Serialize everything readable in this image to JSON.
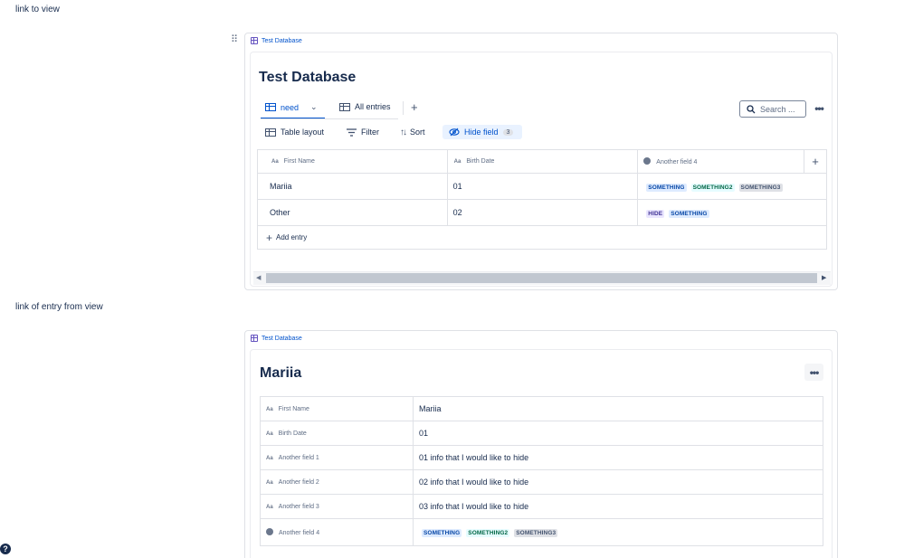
{
  "notes": {
    "top": "link to view",
    "middle": "link of entry from view"
  },
  "view_macro": {
    "db_tag": "Test Database",
    "title": "Test Database",
    "tabs": [
      {
        "label": "need",
        "active": true
      },
      {
        "label": "All entries",
        "active": false
      }
    ],
    "add_tab": "+",
    "search_placeholder": "Search ...",
    "more": "•••",
    "toolbar": {
      "layout": "Table layout",
      "filter": "Filter",
      "sort": "Sort",
      "hide_field": "Hide field",
      "hide_count": "3"
    },
    "columns": [
      "First Name",
      "Birth Date",
      "Another field 4"
    ],
    "add_column": "+",
    "rows": [
      {
        "first_name": "Mariia",
        "birth_date": "01",
        "tags": [
          "SOMETHING",
          "SOMETHING2",
          "SOMETHING3"
        ]
      },
      {
        "first_name": "Other",
        "birth_date": "02",
        "tags": [
          "HIDE",
          "SOMETHING"
        ]
      }
    ],
    "add_entry": "Add entry"
  },
  "entry_macro": {
    "db_tag": "Test Database",
    "title": "Mariia",
    "more": "•••",
    "fields": [
      {
        "label": "First Name",
        "value": "Mariia"
      },
      {
        "label": "Birth Date",
        "value": "01"
      },
      {
        "label": "Another field 1",
        "value": "01 info that I would like to hide"
      },
      {
        "label": "Another field 2",
        "value": "02 info that I would like to hide"
      },
      {
        "label": "Another field 3",
        "value": "03 info that I would like to hide"
      }
    ],
    "select_field": {
      "label": "Another field 4",
      "tags": [
        "SOMETHING",
        "SOMETHING2",
        "SOMETHING3"
      ]
    }
  },
  "icon_text": {
    "aa": "Aa",
    "help": "?"
  },
  "colors": {
    "accent": "#0052cc",
    "tag_blue": "#deebff",
    "tag_teal": "#e6fcff",
    "tag_gray": "#dfe1e6",
    "tag_purple": "#eae6ff"
  }
}
